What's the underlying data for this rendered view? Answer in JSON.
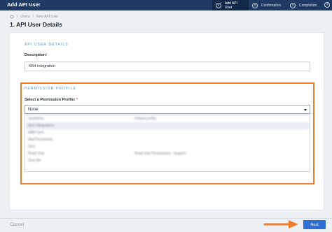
{
  "header": {
    "title": "Add API User",
    "steps": [
      {
        "num": "1",
        "label": "Add API User"
      },
      {
        "num": "2",
        "label": "Confirmation"
      },
      {
        "num": "3",
        "label": "Completion"
      }
    ],
    "help_glyph": "?"
  },
  "breadcrumb": {
    "items": [
      "Users",
      "New API User"
    ],
    "separator": "/"
  },
  "page_title": "1. API User Details",
  "api_user_details": {
    "heading": "API USER DETAILS",
    "description_label": "Description:",
    "description_value": "KB4 Integration"
  },
  "permission_profile": {
    "heading": "PERMISSION PROFILE",
    "select_label": "Select a Permission Profile:",
    "required_mark": "*",
    "selected": "None",
    "options_blurred": [
      {
        "name": "SysAdmin",
        "desc": "Default profile"
      },
      {
        "name": "Item Integrations",
        "desc": ""
      },
      {
        "name": "ABM Sync",
        "desc": ""
      },
      {
        "name": "Mail Permission",
        "desc": ""
      },
      {
        "name": "Quiz",
        "desc": ""
      },
      {
        "name": "Read Only",
        "desc": "Read-only Permissions - Support"
      },
      {
        "name": "Give Me",
        "desc": ""
      }
    ]
  },
  "footer": {
    "cancel_label": "Cancel",
    "next_label": "Next"
  },
  "colors": {
    "header_bg": "#1f3b63",
    "highlight_border": "#f07d2c",
    "primary_button": "#2f6fd4",
    "section_label": "#4f8ed0"
  }
}
